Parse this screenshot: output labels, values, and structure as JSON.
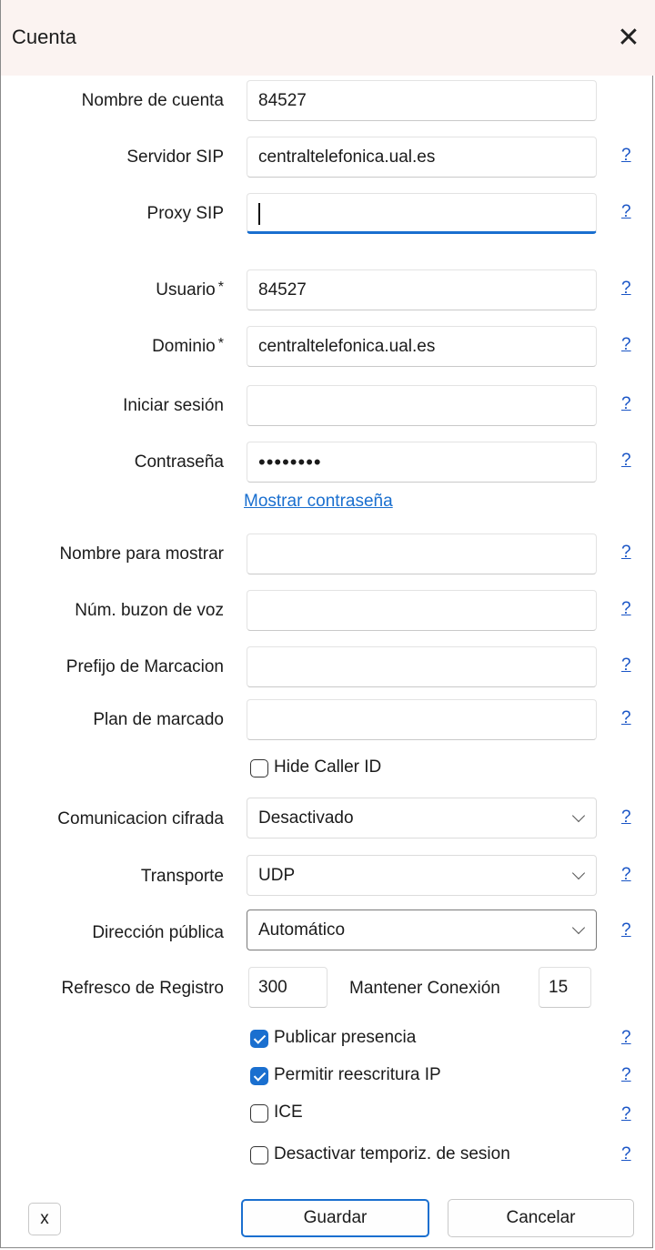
{
  "window": {
    "title": "Cuenta",
    "close_glyph": "✕"
  },
  "fields": {
    "account_name": {
      "label": "Nombre de cuenta",
      "value": "84527"
    },
    "sip_server": {
      "label": "Servidor SIP",
      "value": "centraltelefonica.ual.es"
    },
    "sip_proxy": {
      "label": "Proxy SIP",
      "value": ""
    },
    "user": {
      "label": "Usuario",
      "required_mark": "*",
      "value": "84527"
    },
    "domain": {
      "label": "Dominio",
      "required_mark": "*",
      "value": "centraltelefonica.ual.es"
    },
    "login": {
      "label": "Iniciar sesión",
      "value": ""
    },
    "password": {
      "label": "Contraseña",
      "value": "••••••••"
    },
    "display_name": {
      "label": "Nombre para mostrar",
      "value": ""
    },
    "voicemail": {
      "label": "Núm. buzon de voz",
      "value": ""
    },
    "dial_prefix": {
      "label": "Prefijo de Marcacion",
      "value": ""
    },
    "dial_plan": {
      "label": "Plan de marcado",
      "value": ""
    }
  },
  "show_password_link": "Mostrar contraseña",
  "help_glyph": "?",
  "hide_caller_id": {
    "label": "Hide Caller ID",
    "checked": false
  },
  "selects": {
    "encryption": {
      "label": "Comunicacion cifrada",
      "value": "Desactivado"
    },
    "transport": {
      "label": "Transporte",
      "value": "UDP"
    },
    "public_address": {
      "label": "Dirección pública",
      "value": "Automático"
    }
  },
  "register_refresh": {
    "label": "Refresco de Registro",
    "value": "300"
  },
  "keep_alive": {
    "label": "Mantener Conexión",
    "value": "15"
  },
  "options": [
    {
      "label": "Publicar presencia",
      "checked": true
    },
    {
      "label": "Permitir reescritura IP",
      "checked": true
    },
    {
      "label": "ICE",
      "checked": false
    },
    {
      "label": "Desactivar temporiz. de sesion",
      "checked": false
    }
  ],
  "buttons": {
    "x": "x",
    "save": "Guardar",
    "cancel": "Cancelar"
  },
  "colors": {
    "accent": "#1a6fcf",
    "titlebar": "#fbf3f1",
    "help_link": "#1a55c6"
  },
  "icons": {
    "close": "close-icon",
    "dropdown": "chevron-down-icon",
    "check": "checkmark-icon"
  }
}
